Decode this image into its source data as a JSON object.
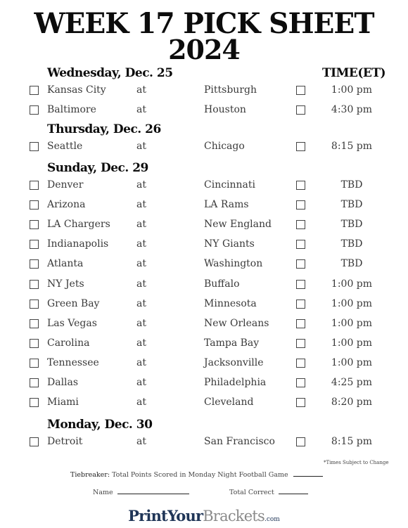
{
  "title": {
    "line1": "WEEK 17 PICK SHEET",
    "line2": "2024"
  },
  "time_header": "TIME(ET)",
  "at_label": "at",
  "days": [
    {
      "label": "Wednesday, Dec. 25",
      "games": [
        {
          "away": "Kansas City",
          "home": "Pittsburgh",
          "time": "1:00 pm"
        },
        {
          "away": "Baltimore",
          "home": "Houston",
          "time": "4:30 pm"
        }
      ]
    },
    {
      "label": "Thursday, Dec. 26",
      "games": [
        {
          "away": "Seattle",
          "home": "Chicago",
          "time": "8:15 pm"
        }
      ]
    },
    {
      "label": "Sunday, Dec. 29",
      "games": [
        {
          "away": "Denver",
          "home": "Cincinnati",
          "time": "TBD"
        },
        {
          "away": "Arizona",
          "home": "LA Rams",
          "time": "TBD"
        },
        {
          "away": "LA Chargers",
          "home": "New England",
          "time": "TBD"
        },
        {
          "away": "Indianapolis",
          "home": "NY Giants",
          "time": "TBD"
        },
        {
          "away": "Atlanta",
          "home": "Washington",
          "time": "TBD"
        },
        {
          "away": "NY Jets",
          "home": "Buffalo",
          "time": "1:00 pm"
        },
        {
          "away": "Green Bay",
          "home": "Minnesota",
          "time": "1:00 pm"
        },
        {
          "away": "Las Vegas",
          "home": "New Orleans",
          "time": "1:00 pm"
        },
        {
          "away": "Carolina",
          "home": "Tampa Bay",
          "time": "1:00 pm"
        },
        {
          "away": "Tennessee",
          "home": "Jacksonville",
          "time": "1:00 pm"
        },
        {
          "away": "Dallas",
          "home": "Philadelphia",
          "time": "4:25 pm"
        },
        {
          "away": "Miami",
          "home": "Cleveland",
          "time": "8:20 pm"
        }
      ]
    },
    {
      "label": "Monday, Dec. 30",
      "games": [
        {
          "away": "Detroit",
          "home": "San Francisco",
          "time": "8:15 pm"
        }
      ]
    }
  ],
  "footer": {
    "note": "*Times Subject to Change",
    "tiebreaker_label": "Tiebreaker:",
    "tiebreaker_text": "Total Points Scored in Monday Night Football Game",
    "name_label": "Name",
    "total_correct_label": "Total Correct",
    "logo": {
      "part1": "PrintYour",
      "part2": "Brackets",
      "part3": ".com",
      "color_primary": "#1f3557",
      "color_secondary": "#8a8a8a"
    }
  }
}
